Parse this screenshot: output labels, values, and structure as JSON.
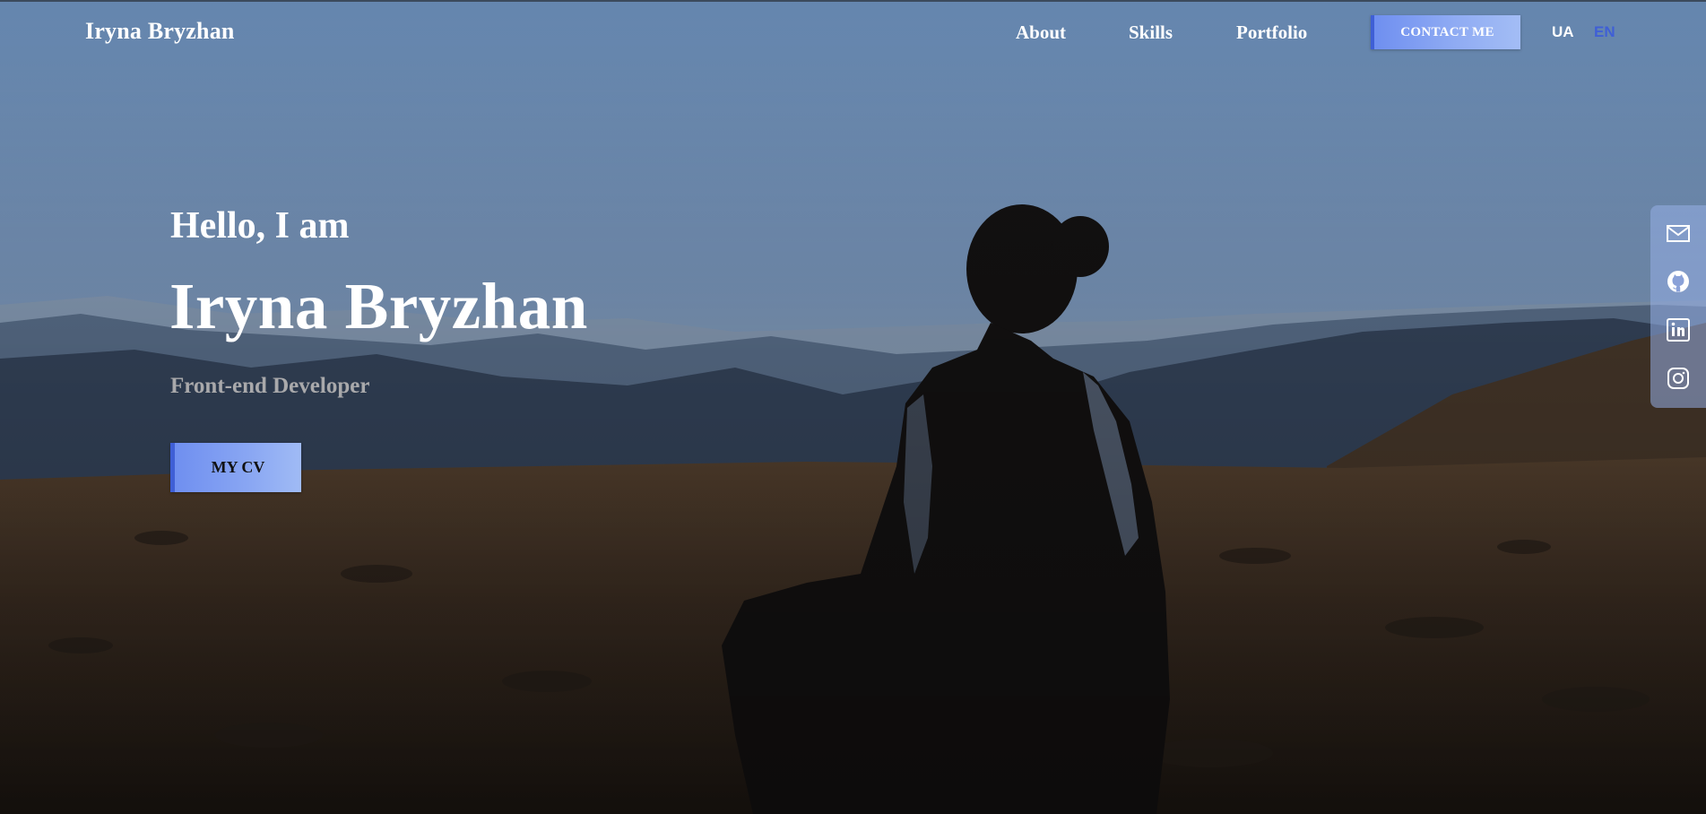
{
  "header": {
    "logo": "Iryna Bryzhan",
    "nav": [
      {
        "label": "About"
      },
      {
        "label": "Skills"
      },
      {
        "label": "Portfolio"
      }
    ],
    "contact_label": "CONTACT ME",
    "languages": [
      {
        "label": "UA",
        "active": false
      },
      {
        "label": "EN",
        "active": true
      }
    ]
  },
  "intro": {
    "greeting": "Hello, I am",
    "name": "Iryna Bryzhan",
    "role": "Front-end Developer",
    "cv_label": "MY CV"
  },
  "social": [
    {
      "icon": "mail-icon"
    },
    {
      "icon": "github-icon"
    },
    {
      "icon": "linkedin-icon"
    },
    {
      "icon": "instagram-icon"
    }
  ],
  "colors": {
    "accent": "#3f5fd6",
    "button_gradient_start": "#6f8ff0",
    "button_gradient_end": "#a3bdf5",
    "role_text": "#a9a9ab"
  }
}
